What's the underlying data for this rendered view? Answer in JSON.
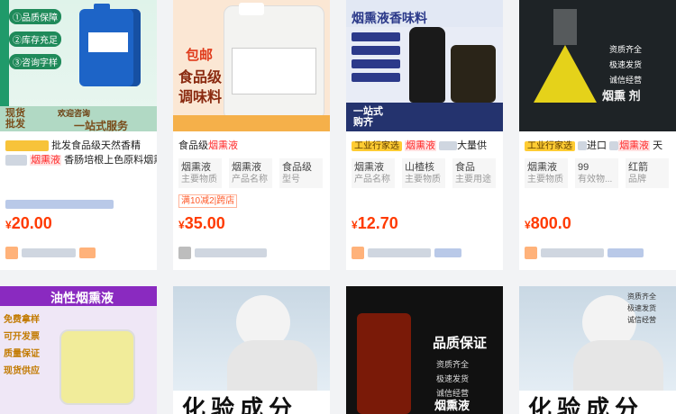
{
  "products": [
    {
      "title_blurred": "",
      "title": "批发食品级天然香精",
      "title_line2_hl": "烟熏液",
      "title_line2": " 香肠培根上色原料烟熏",
      "price_currency": "¥",
      "price": "20.00",
      "image_texts": [
        "①品质保障",
        "②库存充足",
        "③咨询字样"
      ],
      "image_caption_left": "现货批发",
      "image_caption_mid": "欢迎咨询",
      "image_caption_right": "一站式服务"
    },
    {
      "title_prefix": "食品级",
      "title_hl": "烟熏液",
      "attrs": [
        {
          "value": "烟熏液",
          "key": "主要物质"
        },
        {
          "value": "烟熏液",
          "key": "产品名称"
        },
        {
          "value": "食品级",
          "key": "型号"
        }
      ],
      "promo": "满10减2|跨店",
      "price_currency": "¥",
      "price": "35.00",
      "image_big": "包邮",
      "image_line2": "食品级",
      "image_line3": "调味料"
    },
    {
      "tag": "工业行家选",
      "title_hl": "烟熏液",
      "title_suffix": "大量供",
      "attrs": [
        {
          "value": "烟熏液",
          "key": "产品名称"
        },
        {
          "value": "山楂核",
          "key": "主要物质"
        },
        {
          "value": "食品",
          "key": "主要用途"
        }
      ],
      "price_currency": "¥",
      "price": "12.70",
      "image_title": "烟熏液香味料",
      "image_bottom": "一站式购齐"
    },
    {
      "tag": "工业行家选",
      "title_mid": "进口",
      "title_hl": "烟熏液",
      "title_suffix": "天",
      "attrs": [
        {
          "value": "烟熏液",
          "key": "主要物质"
        },
        {
          "value": "99",
          "key": "有效物..."
        },
        {
          "value": "红箭",
          "key": "品牌"
        }
      ],
      "price_currency": "¥",
      "price": "800.0",
      "image_bullets": [
        "资质齐全",
        "极速发货",
        "诚信经营"
      ],
      "image_bottom": "烟熏 剂"
    },
    {
      "image_title": "油性烟熏液",
      "image_bullets": [
        "免费拿样",
        "可开发票",
        "质量保证",
        "现货供应"
      ]
    },
    {
      "image_caption": "化验成分"
    },
    {
      "image_title": "品质保证",
      "image_bullets": [
        "资质齐全",
        "极速发货",
        "诚信经营"
      ],
      "image_bottom": "烟熏液"
    },
    {
      "image_bullets": [
        "资质齐全",
        "极速发货",
        "诚信经营"
      ],
      "image_caption": "化验成分"
    }
  ]
}
